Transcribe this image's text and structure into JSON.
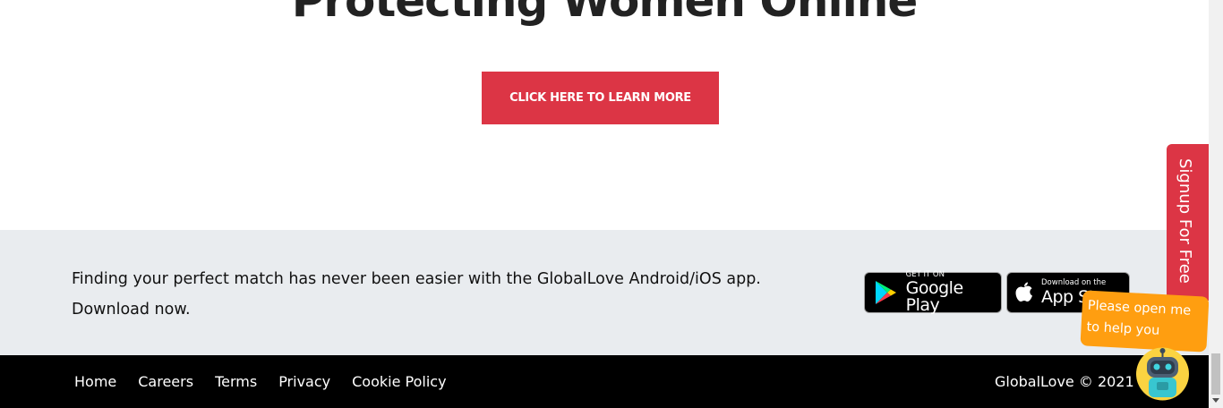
{
  "hero": {
    "title": "Protecting Women Online",
    "cta_label": "CLICK HERE TO LEARN MORE"
  },
  "app_promo": {
    "text_line1": "Finding your perfect match has never been easier with the GlobalLove Android/iOS app.",
    "text_line2": "Download now.",
    "google_play": {
      "small": "GET IT ON",
      "big": "Google Play"
    },
    "app_store": {
      "small": "Download on the",
      "big": "App Store"
    }
  },
  "footer": {
    "links": [
      "Home",
      "Careers",
      "Terms",
      "Privacy",
      "Cookie Policy"
    ],
    "copyright": "GlobalLove © 2021"
  },
  "signup_tab": {
    "label": "Signup For Free"
  },
  "help_bubble": {
    "text_line1": "Please open me",
    "text_line2": "to help you"
  },
  "icons": {
    "google_play": "google-play-icon",
    "app_store": "apple-icon",
    "assistant": "robot-assistant-icon"
  },
  "colors": {
    "accent": "#dc3545",
    "band_bg": "#e9ecef",
    "footer_bg": "#000000",
    "bubble": "#ff9e10"
  }
}
